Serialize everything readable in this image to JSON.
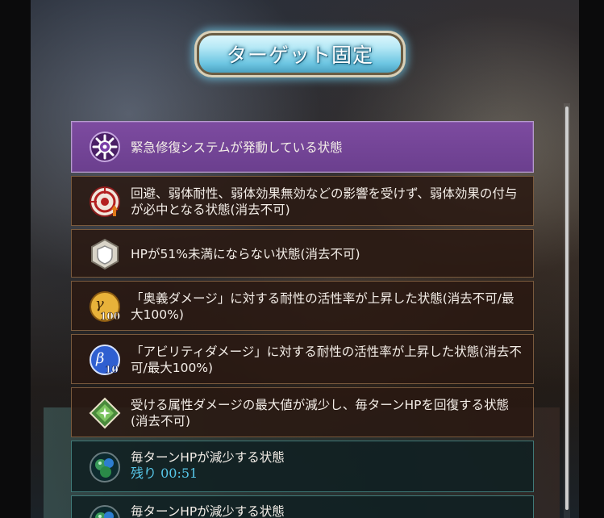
{
  "header": {
    "banner_label": "ターゲット固定"
  },
  "status_list": [
    {
      "text": "緊急修復システムが発動している状態",
      "icon": "repair-gear-icon",
      "state": "active"
    },
    {
      "text": "回避、弱体耐性、弱体効果無効などの影響を受けず、弱体効果の付与が必中となる状態(消去不可)",
      "icon": "target-lock-icon",
      "state": "normal"
    },
    {
      "text": "HPが51%未満にならない状態(消去不可)",
      "icon": "shield-icon",
      "state": "normal"
    },
    {
      "text": "「奥義ダメージ」に対する耐性の活性率が上昇した状態(消去不可/最大100%)",
      "icon": "gamma-100-icon",
      "state": "normal"
    },
    {
      "text": "「アビリティダメージ」に対する耐性の活性率が上昇した状態(消去不可/最大100%)",
      "icon": "beta-10-icon",
      "state": "normal"
    },
    {
      "text": "受ける属性ダメージの最大値が減少し、毎ターンHPを回復する状態(消去不可)",
      "icon": "element-guard-icon",
      "state": "normal"
    },
    {
      "text": "毎ターンHPが減少する状態",
      "timer": "残り 00:51",
      "icon": "poison-icon",
      "state": "timed"
    },
    {
      "text": "毎ターンHPが減少する状態",
      "icon": "poison-icon",
      "state": "timed"
    }
  ],
  "colors": {
    "active_row": "#7d4ba0",
    "row_bg": "#2a1812",
    "row_border": "#7a5a3d",
    "timer_text": "#57c6e8"
  }
}
